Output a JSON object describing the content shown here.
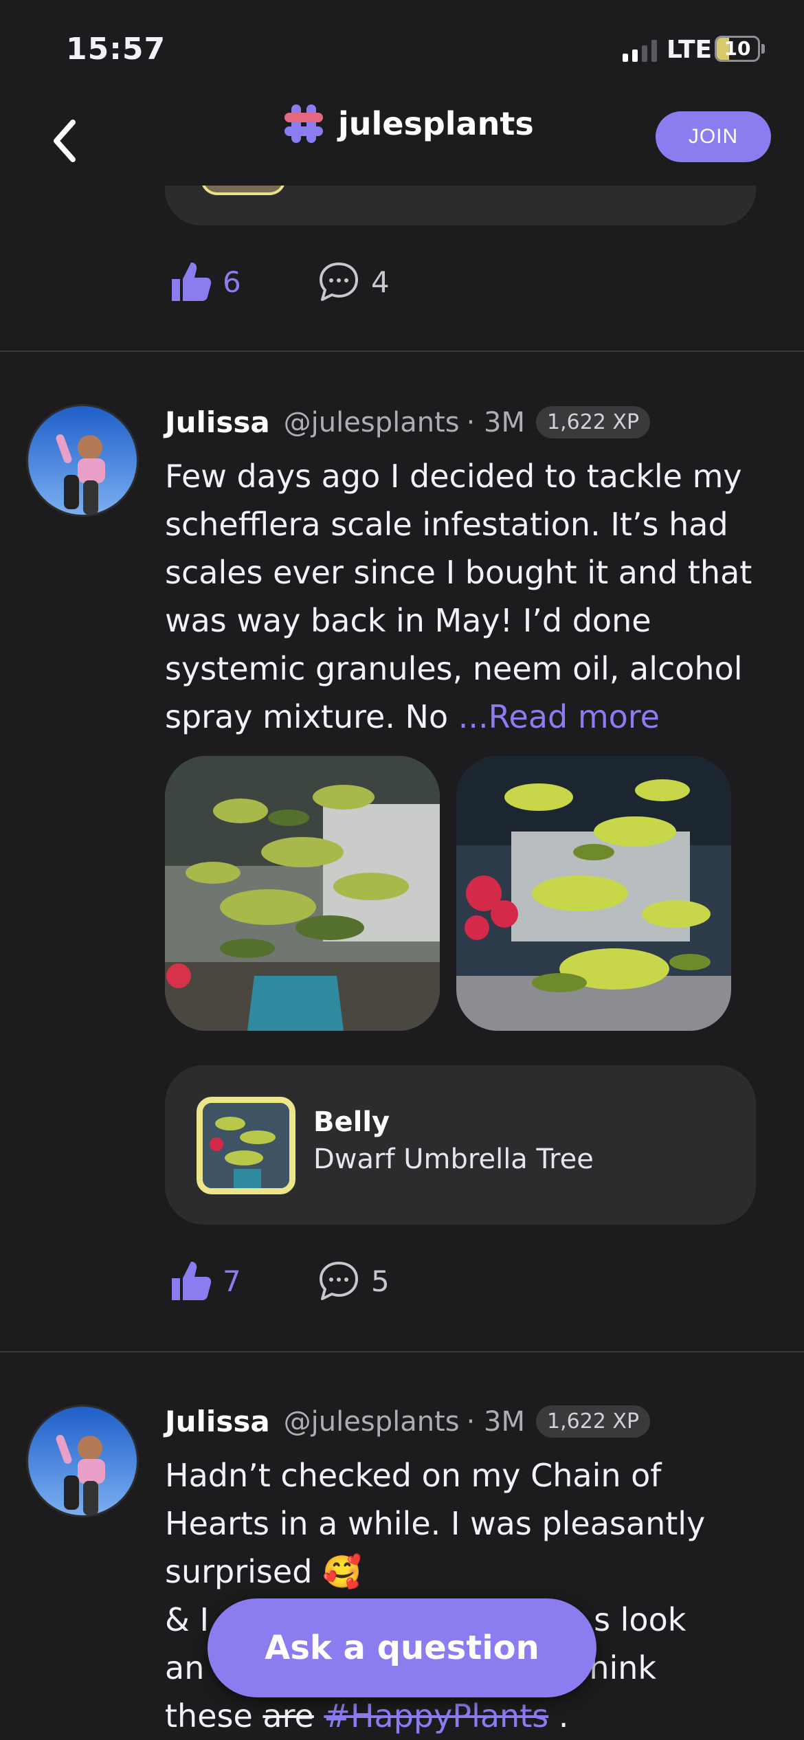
{
  "status_bar": {
    "time": "15:57",
    "network": "LTE",
    "battery": "10"
  },
  "nav": {
    "title": "julesplants",
    "join_label": "JOIN"
  },
  "previous_post": {
    "likes": "6",
    "comments": "4"
  },
  "posts": [
    {
      "author": "Julissa",
      "handle": "@julesplants",
      "age": "· 3M",
      "xp": "1,622 XP",
      "text": "Few days ago I decided to tackle my schefflera scale infestation. It’s had scales ever since I bought it and that was way back in May! I’d done systemic granules, neem oil, alcohol spray mixture. No ",
      "read_more": "...Read more",
      "plant": {
        "name": "Belly",
        "species": "Dwarf Umbrella Tree"
      },
      "likes": "7",
      "comments": "5"
    },
    {
      "author": "Julissa",
      "handle": "@julesplants",
      "age": "· 3M",
      "xp": "1,622 XP",
      "line1": "Hadn’t checked on my Chain of",
      "line2": "Hearts in a while. I was pleasantly",
      "line3": "surprised 🥰",
      "line4a": "& I",
      "line4b": "s look",
      "line5a": "an",
      "line5b": "hink",
      "line6a": "these ",
      "line6_strike": "are",
      "line6_hashtag": "#HappyPlants",
      "line6_end": " ."
    }
  ],
  "ask_button": "Ask a question",
  "colors": {
    "accent": "#8b7cf0",
    "background": "#1c1c1e",
    "card": "#2c2c2e"
  }
}
